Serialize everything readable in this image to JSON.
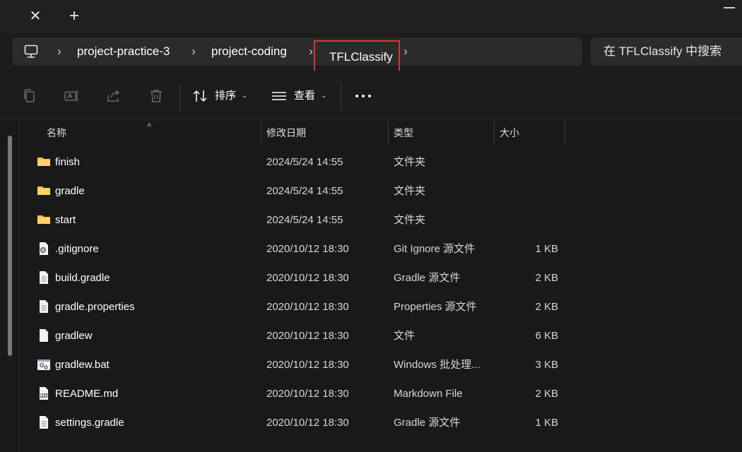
{
  "titlebar": {
    "tabs": [
      {
        "close_glyph": "✕"
      }
    ],
    "add_tab_glyph": "+"
  },
  "address": {
    "root_icon": "computer-icon",
    "separator_glyph": "›",
    "crumbs": [
      "project-practice-3",
      "project-coding",
      "TFLClassify"
    ]
  },
  "search": {
    "placeholder": "在 TFLClassify 中搜索"
  },
  "toolbar": {
    "icons": [
      "copy-icon",
      "rename-icon",
      "share-icon",
      "delete-icon"
    ],
    "sort_label": "排序",
    "view_label": "查看",
    "more_icon": "more-icon"
  },
  "columns": {
    "name": "名称",
    "modified": "修改日期",
    "type": "类型",
    "size": "大小"
  },
  "files": [
    {
      "name": "finish",
      "modified": "2024/5/24 14:55",
      "type": "文件夹",
      "size": "",
      "icon": "folder-icon"
    },
    {
      "name": "gradle",
      "modified": "2024/5/24 14:55",
      "type": "文件夹",
      "size": "",
      "icon": "folder-icon"
    },
    {
      "name": "start",
      "modified": "2024/5/24 14:55",
      "type": "文件夹",
      "size": "",
      "icon": "folder-icon"
    },
    {
      "name": ".gitignore",
      "modified": "2020/10/12 18:30",
      "type": "Git Ignore 源文件",
      "size": "1 KB",
      "icon": "settings-file-icon"
    },
    {
      "name": "build.gradle",
      "modified": "2020/10/12 18:30",
      "type": "Gradle 源文件",
      "size": "2 KB",
      "icon": "text-file-icon"
    },
    {
      "name": "gradle.properties",
      "modified": "2020/10/12 18:30",
      "type": "Properties 源文件",
      "size": "2 KB",
      "icon": "text-file-icon"
    },
    {
      "name": "gradlew",
      "modified": "2020/10/12 18:30",
      "type": "文件",
      "size": "6 KB",
      "icon": "blank-file-icon"
    },
    {
      "name": "gradlew.bat",
      "modified": "2020/10/12 18:30",
      "type": "Windows 批处理...",
      "size": "3 KB",
      "icon": "batch-file-icon"
    },
    {
      "name": "README.md",
      "modified": "2020/10/12 18:30",
      "type": "Markdown File",
      "size": "2 KB",
      "icon": "markdown-file-icon"
    },
    {
      "name": "settings.gradle",
      "modified": "2020/10/12 18:30",
      "type": "Gradle 源文件",
      "size": "1 KB",
      "icon": "text-file-icon"
    }
  ],
  "colors": {
    "folder": "#f3c04a",
    "highlight_border": "#e03232",
    "background": "#191919"
  }
}
